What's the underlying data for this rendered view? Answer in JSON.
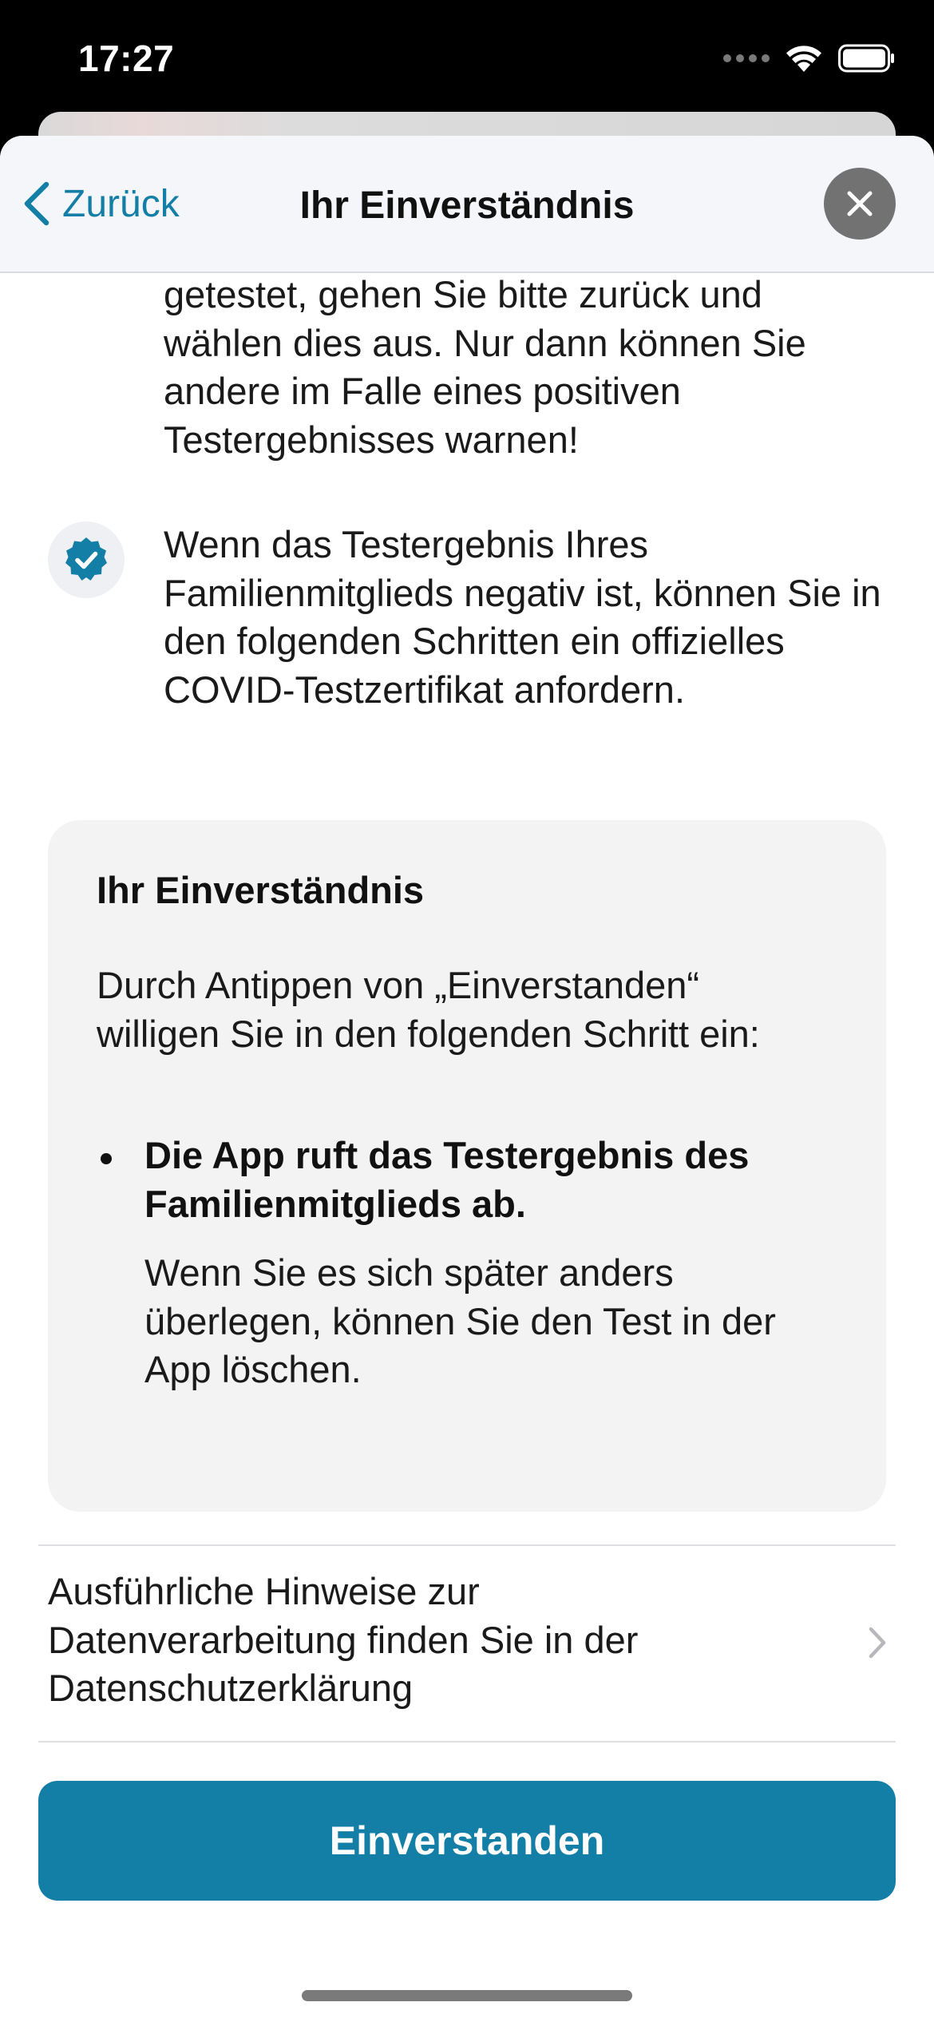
{
  "status_bar": {
    "time": "17:27"
  },
  "nav": {
    "back_label": "Zurück",
    "title": "Ihr Einverständnis"
  },
  "content": {
    "top_paragraph": "getestet, gehen Sie bitte zurück und wählen dies aus. Nur dann können Sie andere im Falle eines positiven Testergebnisses warnen!",
    "check_item_text": "Wenn das Testergebnis Ihres Familienmitglieds negativ ist, können Sie in den folgenden Schritten ein offizielles COVID-Testzertifikat anfordern."
  },
  "consent_card": {
    "title": "Ihr Einverständnis",
    "intro": "Durch Antippen von „Einverstanden“ willigen Sie in den folgenden Schritt ein:",
    "bullet_title": "Die App ruft das Testergebnis des Familienmitglieds ab.",
    "bullet_text": "Wenn Sie es sich später anders überlegen, können Sie den Test in der App löschen."
  },
  "privacy_link": {
    "text": "Ausführliche Hinweise zur Datenverarbeitung finden Sie in der Datenschutzerklärung"
  },
  "primary_button": {
    "label": "Einverstanden"
  },
  "colors": {
    "accent": "#137ea6",
    "card_background": "#f3f3f4",
    "nav_background": "#f4f6f9"
  },
  "icons": {
    "back": "chevron-left-icon",
    "close": "close-icon",
    "check": "verified-check-icon",
    "privacy_chevron": "chevron-right-icon",
    "wifi": "wifi-icon",
    "battery": "battery-icon"
  }
}
